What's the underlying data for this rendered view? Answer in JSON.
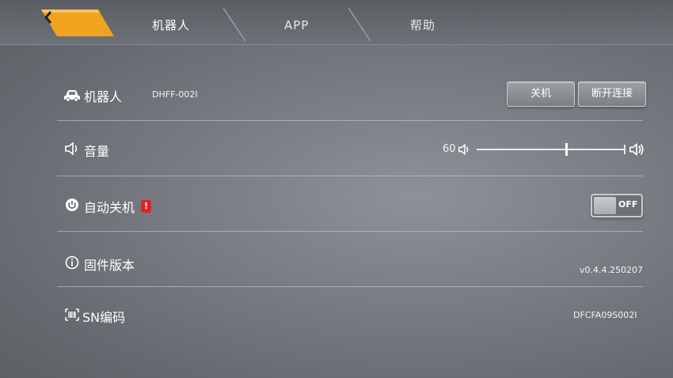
{
  "nav": {
    "tabs": [
      {
        "label": "机器人",
        "active": true
      },
      {
        "label": "APP",
        "active": false
      },
      {
        "label": "帮助",
        "active": false
      }
    ]
  },
  "robot": {
    "label": "机器人",
    "model": "DHFF-002I",
    "shutdown_label": "关机",
    "disconnect_label": "断开连接"
  },
  "volume": {
    "label": "音量",
    "value_text": "60",
    "level_percent": 60
  },
  "auto_shutdown": {
    "label": "自动关机",
    "alert_mark": "!",
    "toggle_label": "OFF"
  },
  "firmware": {
    "label": "固件版本",
    "value": "v0.4.4.250207"
  },
  "sn": {
    "label": "SN编码",
    "value": "DFCFA09S002I"
  },
  "colors": {
    "accent": "#f5a623",
    "alert": "#d8262b"
  },
  "icons": [
    "back-chevron-icon",
    "car-icon",
    "speaker-icon",
    "power-icon",
    "info-icon",
    "barcode-icon"
  ]
}
